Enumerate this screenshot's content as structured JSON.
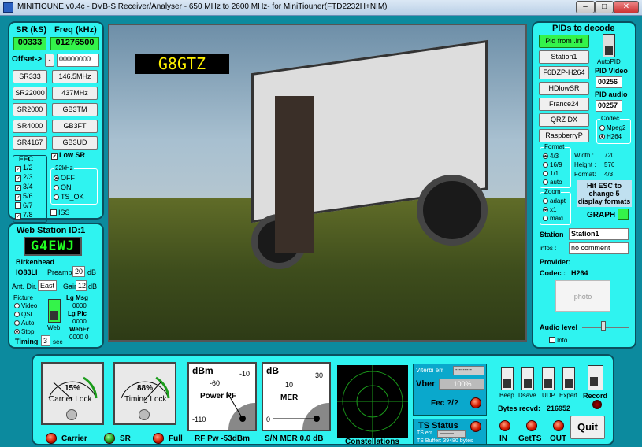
{
  "window": {
    "title": "MINITIOUNE v0.4c - DVB-S Receiver/Analyser - 650 MHz to 2600 MHz- for MiniTiouner(FTD2232H+NIM)"
  },
  "sr": {
    "sr_label": "SR (kS)",
    "freq_label": "Freq (kHz)",
    "sr_value": "00333",
    "freq_value": "01276500",
    "offset_label": "Offset->",
    "offset_minus": "-",
    "offset_value": "00000000",
    "presets": [
      "SR333",
      "146.5MHz",
      "SR22000",
      "437MHz",
      "SR2000",
      "GB3TM",
      "SR4000",
      "GB3FT",
      "SR4167",
      "GB3UD"
    ]
  },
  "fec": {
    "title": "FEC",
    "items": [
      {
        "label": "1/2",
        "checked": true
      },
      {
        "label": "2/3",
        "checked": true
      },
      {
        "label": "3/4",
        "checked": true
      },
      {
        "label": "5/6",
        "checked": true
      },
      {
        "label": "6/7",
        "checked": false
      },
      {
        "label": "7/8",
        "checked": true
      }
    ],
    "low_sr": "Low SR",
    "k22_title": "22kHz",
    "k22_opts": [
      "OFF",
      "ON",
      "TS_OK"
    ],
    "iss": "ISS"
  },
  "web": {
    "title": "Web Station ID:1",
    "callsign": "G4EWJ",
    "location": "Birkenhead",
    "locator": "IO83LI",
    "preamp_label": "Preamp",
    "preamp_value": "20",
    "preamp_unit": "dB",
    "ant_label": "Ant. Dir.",
    "ant_value": "East",
    "gain_label": "Gain",
    "gain_value": "12",
    "gain_unit": "dB",
    "picture_title": "Picture",
    "picture_opts": [
      "Video",
      "QSL",
      "Auto",
      "Stop"
    ],
    "web_label": "Web",
    "lg_msg_label": "Lg Msg",
    "lg_msg_value": "0000",
    "lg_pic_label": "Lg Pic",
    "lg_pic_value": "0000",
    "weber_label": "WebEr",
    "weber_value": "0000 0",
    "timing_label": "Timing",
    "timing_value": "3",
    "timing_unit": "sec"
  },
  "video": {
    "overlay_call": "G8GTZ"
  },
  "pids": {
    "title": "PIDs to decode",
    "pid_from_ini": "Pid from .ini",
    "stations": [
      "Station1",
      "F6DZP-H264",
      "HDlowSR",
      "France24",
      "QRZ DX",
      "RaspberryP"
    ],
    "autopid": "AutoPID",
    "pid_video_label": "PID Video",
    "pid_video": "00256",
    "pid_audio_label": "PID audio",
    "pid_audio": "00257",
    "codec_title": "Codec",
    "codec_opts": [
      "Mpeg2",
      "H264"
    ],
    "format_title": "Format",
    "format_opts": [
      "4/3",
      "16/9",
      "1/1",
      "auto"
    ],
    "width_label": "Width :",
    "width_value": "720",
    "height_label": "Height :",
    "height_value": "576",
    "format_label": "Format:",
    "format_value": "4/3",
    "zoom_title": "Zoom",
    "zoom_opts": [
      "adapt",
      "x1",
      "maxi"
    ],
    "esc_note": "Hit ESC to change 5 display formats",
    "graph": "GRAPH",
    "station_label": "Station",
    "station_value": "Station1",
    "infos_label": "infos :",
    "infos_value": "no comment",
    "provider_label": "Provider:",
    "codec_label": "Codec :",
    "codec_value": "H264",
    "photo": "photo",
    "audio_label": "Audio level",
    "info_label": "Info"
  },
  "bottom": {
    "carrier_lock_pct": "15%",
    "carrier_lock_label": "Carrier Lock",
    "timing_lock_pct": "88%",
    "timing_lock_label": "Timing Lock",
    "power_unit": "dBm",
    "power_ticks": [
      "-60",
      "-10",
      "-110"
    ],
    "power_label": "Power RF",
    "mer_unit": "dB",
    "mer_ticks": [
      "10",
      "30",
      "0"
    ],
    "mer_label": "MER",
    "viterbi_label": "Viterbi err",
    "viterbi_value": "---------",
    "vber_label": "Vber",
    "vber_value": "100%",
    "fec_label": "Fec ?/?",
    "ts_status": "TS Status",
    "ts_err_label": "TS err",
    "ts_err_value": "---------",
    "ts_buffer": "TS Buffer: 39480 bytes",
    "switches": [
      "Beep",
      "Dsave",
      "UDP",
      "Expert",
      "Record"
    ],
    "bytes_label": "Bytes recvd:",
    "bytes_value": "216952",
    "leds_in": "IN",
    "leds_getts": "GetTS",
    "leds_out": "OUT",
    "quit": "Quit",
    "carrier": "Carrier",
    "sr_led": "SR",
    "full": "Full",
    "rf_pw": "RF Pw  -53dBm",
    "sn_mer": "S/N MER  0.0 dB",
    "constellations": "Constellations"
  }
}
